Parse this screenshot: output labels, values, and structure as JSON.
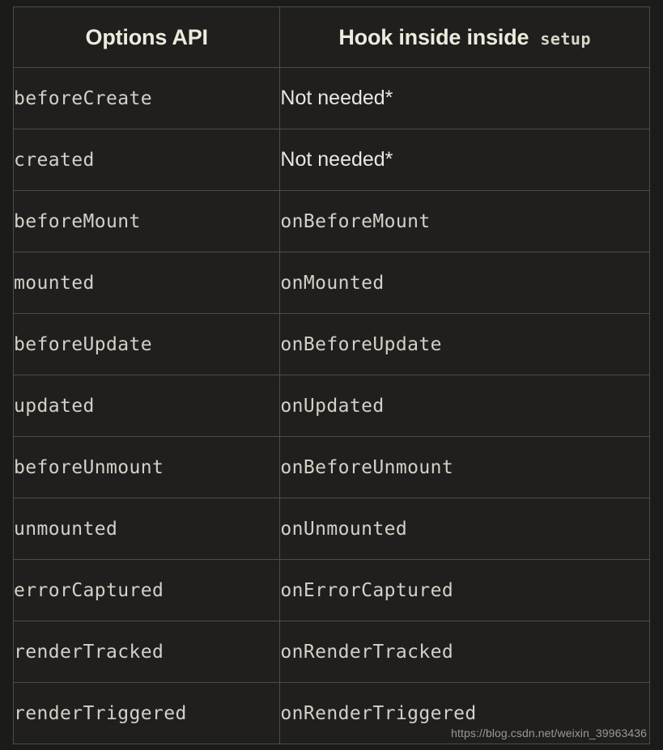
{
  "theme": {
    "page_background": "#1b1b19",
    "table_background": "#201f1d",
    "border_color": "#4d4d47",
    "header_text_color": "#efeade",
    "code_text_color": "#d2d1c8",
    "sans_text_color": "#e9e7df",
    "watermark_color": "#9a988f"
  },
  "table": {
    "headers": {
      "col1": "Options API",
      "col2_text": "Hook inside inside",
      "col2_code": "setup"
    },
    "rows": [
      {
        "option": "beforeCreate",
        "hook": "Not needed*",
        "hook_style": "sans"
      },
      {
        "option": "created",
        "hook": "Not needed*",
        "hook_style": "sans"
      },
      {
        "option": "beforeMount",
        "hook": "onBeforeMount",
        "hook_style": "mono"
      },
      {
        "option": "mounted",
        "hook": "onMounted",
        "hook_style": "mono"
      },
      {
        "option": "beforeUpdate",
        "hook": "onBeforeUpdate",
        "hook_style": "mono"
      },
      {
        "option": "updated",
        "hook": "onUpdated",
        "hook_style": "mono"
      },
      {
        "option": "beforeUnmount",
        "hook": "onBeforeUnmount",
        "hook_style": "mono"
      },
      {
        "option": "unmounted",
        "hook": "onUnmounted",
        "hook_style": "mono"
      },
      {
        "option": "errorCaptured",
        "hook": "onErrorCaptured",
        "hook_style": "mono"
      },
      {
        "option": "renderTracked",
        "hook": "onRenderTracked",
        "hook_style": "mono"
      },
      {
        "option": "renderTriggered",
        "hook": "onRenderTriggered",
        "hook_style": "mono"
      }
    ]
  },
  "watermark": {
    "text": "https://blog.csdn.net/weixin_39963436"
  }
}
